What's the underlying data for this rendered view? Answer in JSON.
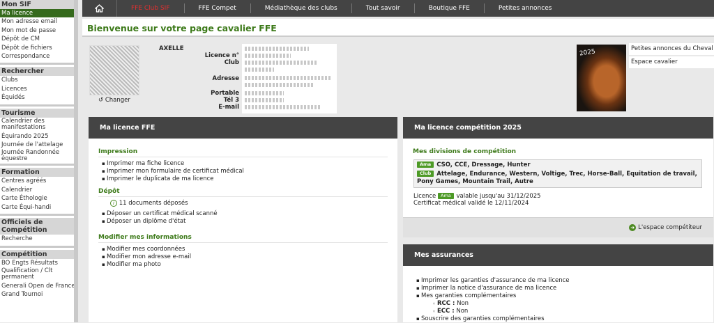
{
  "sidebar": {
    "sections": [
      {
        "title": "Mon SIF",
        "items": [
          "Ma licence",
          "Mon adresse email",
          "Mon mot de passe",
          "Dépôt de CM",
          "Dépôt de fichiers",
          "Correspondance"
        ]
      },
      {
        "title": "Rechercher",
        "items": [
          "Clubs",
          "Licences",
          "Équidés"
        ]
      },
      {
        "title": "Tourisme",
        "items": [
          "Calendrier des manifestations",
          "Équirando 2025",
          "Journée de l'attelage",
          "Journée Randonnée équestre"
        ]
      },
      {
        "title": "Formation",
        "items": [
          "Centres agréés",
          "Calendrier",
          "Carte Éthologie",
          "Carte Équi-handi"
        ]
      },
      {
        "title": "Officiels de Compétition",
        "items": [
          "Recherche"
        ]
      },
      {
        "title": "Compétition",
        "items": [
          "BO Engts Résultats",
          "Qualification / Clt permanent",
          "Generali Open de France",
          "Grand Tournoi"
        ]
      }
    ]
  },
  "nav": {
    "items": [
      "FFE Club SIF",
      "FFE Compet",
      "Médiathèque des clubs",
      "Tout savoir",
      "Boutique FFE",
      "Petites annonces"
    ]
  },
  "page_title": "Bienvenue sur votre page cavalier FFE",
  "profile": {
    "name": "AXELLE",
    "change_label": "Changer",
    "labels": [
      "Licence n°",
      "Club",
      "Adresse",
      "Portable",
      "Tél 3",
      "E-mail"
    ]
  },
  "ads": {
    "links": [
      "Petites annonces du Cheval",
      "Espace cavalier"
    ],
    "year": "2025"
  },
  "licence_panel": {
    "title": "Ma licence FFE",
    "impression_title": "Impression",
    "impression_items": [
      "Imprimer ma fiche licence",
      "Imprimer mon formulaire de certificat médical",
      "Imprimer le duplicata de ma licence"
    ],
    "depot_title": "Dépôt",
    "depot_info": "11 documents déposés",
    "depot_items": [
      "Déposer un certificat médical scanné",
      "Déposer un diplôme d'état"
    ],
    "modify_title": "Modifier mes informations",
    "modify_items": [
      "Modifier mes coordonnées",
      "Modifier mon adresse e-mail",
      "Modifier ma photo"
    ]
  },
  "competition_panel": {
    "title": "Ma licence compétition 2025",
    "divisions_title": "Mes divisions de compétition",
    "badge_ama": "Ama",
    "badge_club": "Club",
    "ama_disciplines": "CSO, CCE, Dressage, Hunter",
    "club_disciplines": "Attelage, Endurance, Western, Voltige, Trec, Horse-Ball, Equitation de travail, Pony Games, Mountain Trail, Autre",
    "licence_prefix": "Licence",
    "licence_valid": "valable jusqu'au 31/12/2025",
    "certificat": "Certificat médical validé le 12/11/2024",
    "espace_link": "L'espace compétiteur"
  },
  "assurances_panel": {
    "title": "Mes assurances",
    "items": [
      "Imprimer les garanties d'assurance de ma licence",
      "Imprimer la notice d'assurance de ma licence",
      "Mes garanties complémentaires"
    ],
    "rcc_label": "RCC :",
    "rcc_value": "Non",
    "ecc_label": "ECC :",
    "ecc_value": "Non",
    "last_item": "Souscrire des garanties complémentaires"
  }
}
